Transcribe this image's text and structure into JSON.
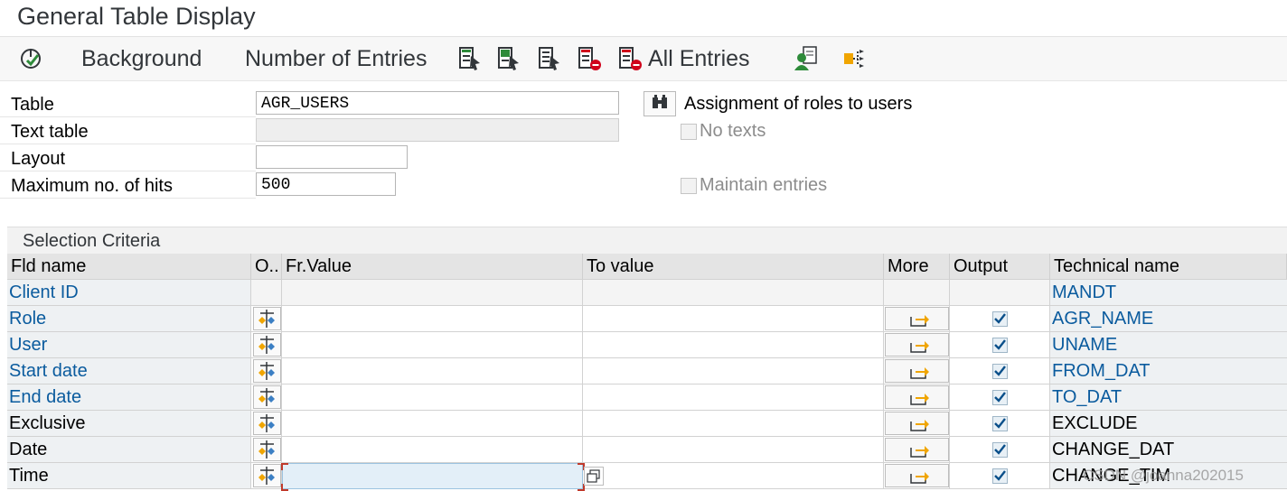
{
  "window": {
    "title": "General Table Display"
  },
  "toolbar": {
    "background_label": "Background",
    "number_of_entries_label": "Number of Entries",
    "all_entries_label": "All Entries"
  },
  "form": {
    "table_label": "Table",
    "table_value": "AGR_USERS",
    "text_table_label": "Text table",
    "text_table_value": "",
    "layout_label": "Layout",
    "layout_value": "",
    "max_hits_label": "Maximum no. of hits",
    "max_hits_value": "500",
    "table_description": "Assignment of roles to users",
    "no_texts_label": "No texts",
    "maintain_entries_label": "Maintain entries"
  },
  "selection": {
    "header": "Selection Criteria",
    "columns": {
      "fld_name": "Fld name",
      "option": "O..",
      "from_value": "Fr.Value",
      "to_value": "To value",
      "more": "More",
      "output": "Output",
      "technical_name": "Technical name"
    },
    "rows": [
      {
        "name": "Client ID",
        "tech": "MANDT",
        "key": true,
        "output": false,
        "editable": false
      },
      {
        "name": "Role",
        "tech": "AGR_NAME",
        "key": true,
        "output": true,
        "editable": true
      },
      {
        "name": "User",
        "tech": "UNAME",
        "key": true,
        "output": true,
        "editable": true
      },
      {
        "name": "Start date",
        "tech": "FROM_DAT",
        "key": true,
        "output": true,
        "editable": true
      },
      {
        "name": "End date",
        "tech": "TO_DAT",
        "key": true,
        "output": true,
        "editable": true
      },
      {
        "name": "Exclusive",
        "tech": "EXCLUDE",
        "key": false,
        "output": true,
        "editable": true
      },
      {
        "name": "Date",
        "tech": "CHANGE_DAT",
        "key": false,
        "output": true,
        "editable": true
      },
      {
        "name": "Time",
        "tech": "CHANGE_TIM",
        "key": false,
        "output": true,
        "editable": true
      }
    ]
  },
  "watermark": "CSDN @joanna202015",
  "colors": {
    "key_field": "#0a5b9e",
    "green": "#2e8b3a",
    "red": "#d0021b",
    "orange": "#f0a500"
  }
}
